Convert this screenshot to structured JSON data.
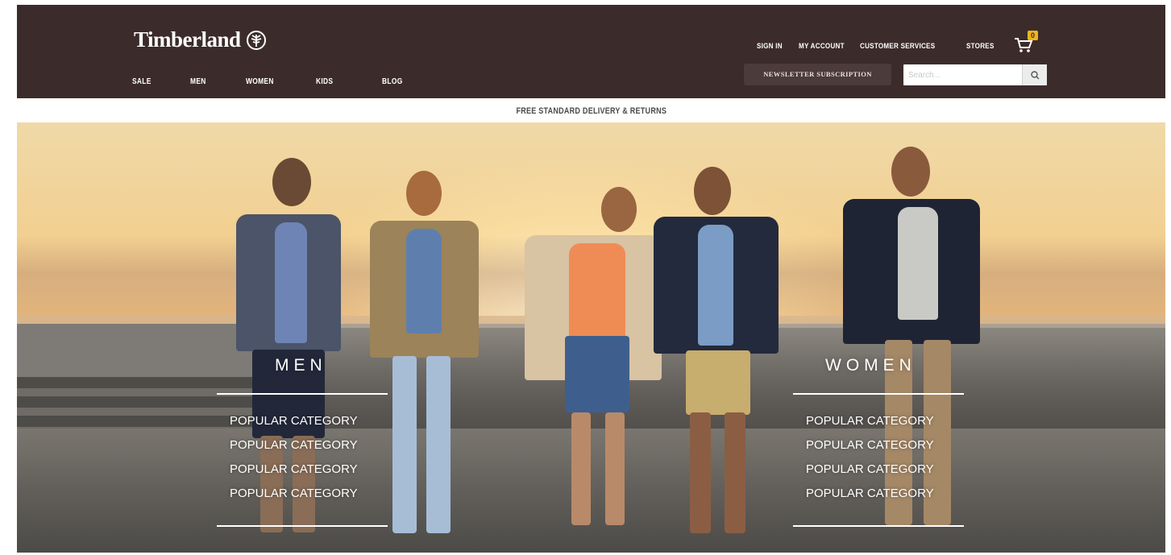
{
  "brand": {
    "name": "Timberland"
  },
  "header": {
    "top_links": [
      "SIGN IN",
      "MY ACCOUNT",
      "CUSTOMER SERVICES",
      "STORES"
    ],
    "cart": {
      "count": "0",
      "icon": "cart-icon"
    },
    "nav": [
      "SALE",
      "MEN",
      "WOMEN",
      "KIDS",
      "BLOG"
    ],
    "newsletter_label": "NEWSLETTER SUBSCRIPTION",
    "search": {
      "placeholder": "Search...",
      "value": "",
      "icon": "search-icon"
    }
  },
  "promo": {
    "text": "FREE STANDARD DELIVERY & RETURNS"
  },
  "hero": {
    "men": {
      "title": "MEN",
      "links": [
        "POPULAR CATEGORY",
        "POPULAR CATEGORY",
        "POPULAR CATEGORY",
        "POPULAR CATEGORY"
      ]
    },
    "women": {
      "title": "WOMEN",
      "links": [
        "POPULAR CATEGORY",
        "POPULAR CATEGORY",
        "POPULAR CATEGORY",
        "POPULAR CATEGORY"
      ]
    }
  },
  "colors": {
    "header_bg": "#3b2c2b",
    "badge": "#f0b31e",
    "text_light": "#ffffff"
  }
}
